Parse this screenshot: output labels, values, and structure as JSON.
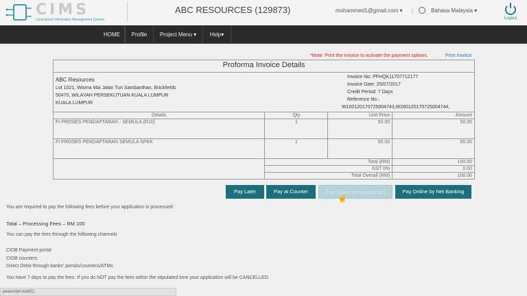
{
  "header": {
    "logo_text": "CIMS",
    "logo_subtitle": "Centralized Information Management System",
    "company": "ABC RESOURCES (129873)",
    "user_email": "mohammed1@gmail.com ▾",
    "language": "Bahasa Malaysia ▾",
    "logout": "Logout"
  },
  "nav": [
    "HOME",
    "Profile",
    "Project Menu ▾",
    "Help▾"
  ],
  "note": "*Note: Print the invoice to activate the payment options.",
  "print_invoice": "Print Invoice",
  "invoice": {
    "title": "Proforma Invoice Details",
    "company_name": "ABC Resources",
    "address": [
      "Lot 1021, Wisma Mai Jalan Tun Sambanthan, Brickfields",
      "50470, WILAYAH PERSEKUTUAN KUALA LUMPUR",
      "KUALA LUMPUR"
    ],
    "meta": [
      "Invoice No: PFHQK11707712177",
      "Invoice Date: 25/07/2017",
      "Credit Period: 7 Days",
      "Reference No.:",
      "W100120170725004743,W260120170725004744,"
    ],
    "columns": [
      "Details",
      "Qty",
      "Unit Price",
      "Amount"
    ],
    "rows": [
      [
        "FI PROSES PENDAFTARAN - SEMULA (R10)",
        "1",
        "50.00",
        "50.00"
      ],
      [
        "FI PROSES PENDAFTARAN SEMULA SPKK",
        "1",
        "50.00",
        "50.00"
      ]
    ],
    "totals": [
      [
        "Total (RM)",
        "100.00"
      ],
      [
        "GST 0%",
        "0.00"
      ],
      [
        "Total Overall (RM)",
        "100.00"
      ]
    ]
  },
  "buttons": [
    "Pay Later",
    "Pay at Counter",
    "Pay Online by Credit Card",
    "Pay Online by Net Banking"
  ],
  "body_text": [
    "You are required to pay the following fees before your application is processed:",
    "Total – Processing Fees – RM 100",
    "You can pay the fees through the following channels",
    "CIDB Payment portal",
    "CIDB counters",
    "Direct Debit through banks' portals/counters/ATMs",
    "You have 7 days to pay the fees. If you do NOT pay the fees within the stipulated time your application will be CANCELLED."
  ],
  "status_bar": "javascript:void(0);",
  "colors": {
    "accent": "#1e6f7c",
    "nav": "#2b2b2b",
    "note": "#e02020"
  }
}
